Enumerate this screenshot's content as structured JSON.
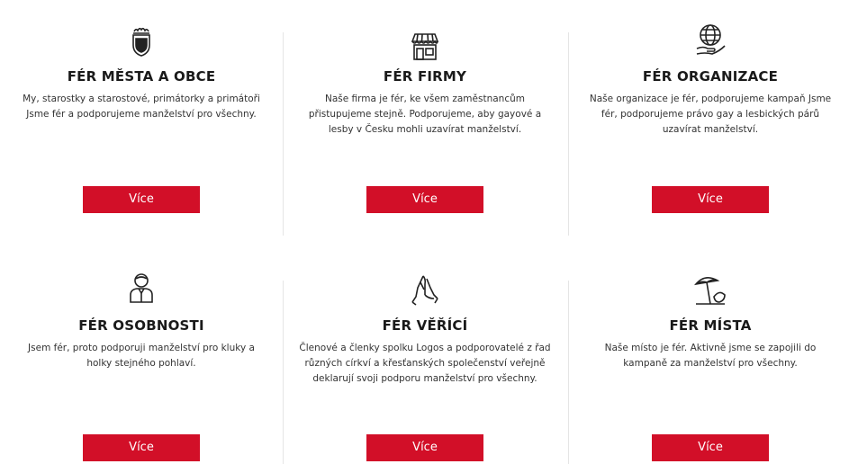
{
  "accent_color": "#d20f28",
  "cards": [
    {
      "title": "FÉR MĚSTA A OBCE",
      "text": "My, starostky a starostové, primátorky a primátoři Jsme fér a podporujeme manželství pro všechny.",
      "button": "Více",
      "icon": "coat-of-arms-icon"
    },
    {
      "title": "FÉR FIRMY",
      "text": "Naše firma je fér, ke všem zaměstnancům přistupujeme stejně. Podporujeme, aby gayové a lesby v Česku mohli uzavírat manželství.",
      "button": "Více",
      "icon": "shop-icon"
    },
    {
      "title": "FÉR ORGANIZACE",
      "text": "Naše organizace je fér, podporujeme kampaň Jsme fér, podporujeme právo gay a lesbických párů uzavírat manželství.",
      "button": "Více",
      "icon": "globe-in-hand-icon"
    },
    {
      "title": "FÉR OSOBNOSTI",
      "text": "Jsem fér, proto podporuji manželství pro kluky a holky stejného pohlaví.",
      "button": "Více",
      "icon": "person-icon"
    },
    {
      "title": "FÉR VĚŘÍCÍ",
      "text": "Členové a členky spolku Logos a podporovatelé z řad různých církví a křesťanských společenství veřejně deklarují svoji podporu manželství pro všechny.",
      "button": "Více",
      "icon": "praying-hands-icon"
    },
    {
      "title": "FÉR MÍSTA",
      "text": "Naše místo je fér. Aktivně jsme se zapojili do kampaně za manželství pro všechny.",
      "button": "Více",
      "icon": "beach-umbrella-icon"
    }
  ]
}
